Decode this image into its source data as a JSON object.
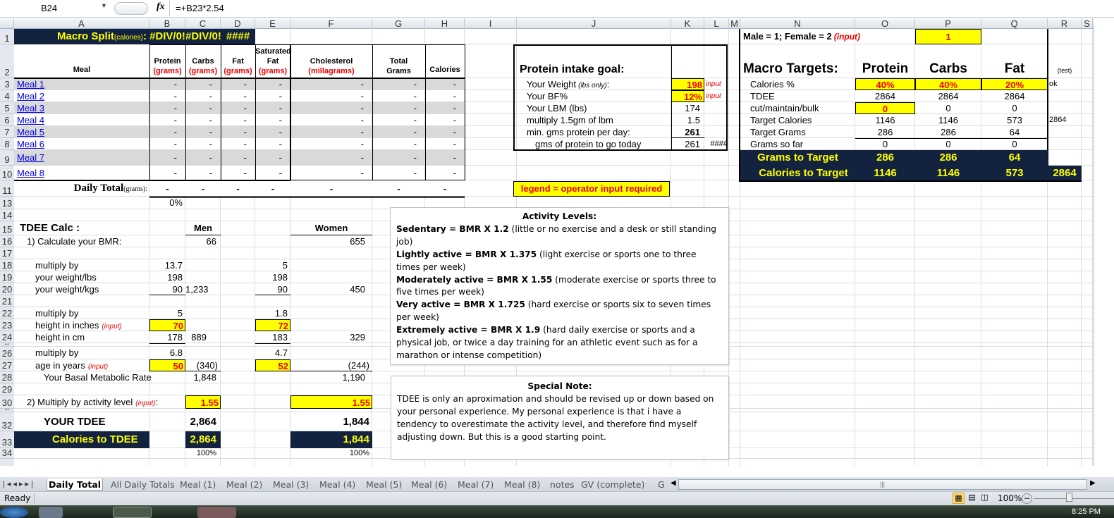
{
  "formula_bar": {
    "name_box": "B24",
    "fx_icon": "fx",
    "formula": "=+B23*2.54"
  },
  "columns": [
    "A",
    "B",
    "C",
    "D",
    "E",
    "F",
    "G",
    "H",
    "I",
    "J",
    "K",
    "L",
    "M",
    "N",
    "O",
    "P",
    "Q",
    "R",
    "S"
  ],
  "rows": [
    "1",
    "2",
    "3",
    "4",
    "5",
    "6",
    "7",
    "8",
    "9",
    "10",
    "11",
    "13",
    "14",
    "15",
    "16",
    "17",
    "18",
    "19",
    "20",
    "21",
    "22",
    "23",
    "24",
    "25",
    "26",
    "27",
    "28",
    "29",
    "30",
    "31",
    "32",
    "33",
    "34"
  ],
  "macro_split": {
    "label": "Macro Split",
    "label_sub": "(calories)",
    "label_colon": ":",
    "protein": "#DIV/0!",
    "carbs": "#DIV/0!",
    "fat": "####"
  },
  "meal_table": {
    "headers": {
      "meal": "Meal",
      "protein": "Protein",
      "carbs": "Carbs",
      "fat": "Fat",
      "sat1": "Saturated",
      "sat2": "Fat",
      "chol": "Cholesterol",
      "total1": "Total",
      "total2": "Grams",
      "calories": "Calories",
      "grams": "(grams)",
      "mg": "(millagrams)"
    },
    "meals": [
      {
        "name": "Meal 1",
        "values": [
          "-",
          "-",
          "-",
          "-",
          "-",
          "-",
          "-"
        ]
      },
      {
        "name": "Meal 2",
        "values": [
          "-",
          "-",
          "-",
          "-",
          "-",
          "-",
          "-"
        ]
      },
      {
        "name": "Meal 3",
        "values": [
          "-",
          "-",
          "-",
          "-",
          "-",
          "-",
          "-"
        ]
      },
      {
        "name": "Meal 4",
        "values": [
          "-",
          "-",
          "-",
          "-",
          "-",
          "-",
          "-"
        ]
      },
      {
        "name": "Meal 5",
        "values": [
          "-",
          "-",
          "-",
          "-",
          "-",
          "-",
          "-"
        ]
      },
      {
        "name": "Meal 6",
        "values": [
          "-",
          "-",
          "-",
          "-",
          "-",
          "-",
          "-"
        ]
      },
      {
        "name": "Meal 7",
        "values": [
          "-",
          "-",
          "-",
          "-",
          "-",
          "-",
          "-"
        ]
      },
      {
        "name": "Meal 8",
        "values": [
          "-",
          "-",
          "-",
          "-",
          "-",
          "-",
          "-"
        ]
      }
    ],
    "daily_total_label": "Daily Total",
    "daily_total_sub": "(grams):",
    "daily_total": [
      "-",
      "-",
      "-",
      "-",
      "-",
      "-",
      "-"
    ],
    "pct": "0%"
  },
  "protein_goal": {
    "title": "Protein intake goal:",
    "weight_label": "Your Weight",
    "weight_sub": "(lbs only)",
    "weight_colon": ":",
    "weight": "198",
    "input_note": "input",
    "bf_label": "Your BF%",
    "bf": "12%",
    "lbm_label": "Your LBM (lbs)",
    "lbm": "174",
    "mult_label": "multiply 1.5gm of lbm",
    "mult": "1.5",
    "min_label": "min. gms protein per day:",
    "min": "261",
    "togo_label": "gms of protein to go today",
    "togo": "261",
    "togo_extra": "####"
  },
  "legend": "legend = operator input required",
  "gender": {
    "label": "Male = 1; Female = 2",
    "note": "(input)",
    "value": "1"
  },
  "macro_targets": {
    "title": "Macro Targets:",
    "cols": [
      "Protein",
      "Carbs",
      "Fat"
    ],
    "test": "(test)",
    "rows": [
      {
        "label": "Calories %",
        "values": [
          "40%",
          "40%",
          "20%"
        ],
        "extra": "ok"
      },
      {
        "label": "TDEE",
        "values": [
          "2864",
          "2864",
          "2864"
        ],
        "extra": ""
      },
      {
        "label": "cut/maintain/bulk",
        "values": [
          "0",
          "0",
          "0"
        ],
        "extra": ""
      },
      {
        "label": "Target Calories",
        "values": [
          "1146",
          "1146",
          "573"
        ],
        "extra": "2864"
      },
      {
        "label": "Target Grams",
        "values": [
          "286",
          "286",
          "64"
        ],
        "extra": ""
      },
      {
        "label": "Grams so far",
        "values": [
          "0",
          "0",
          "0"
        ],
        "extra": ""
      }
    ],
    "grams_to_target": {
      "label": "Grams to Target",
      "values": [
        "286",
        "286",
        "64"
      ]
    },
    "calories_to_target": {
      "label": "Calories to Target",
      "values": [
        "1146",
        "1146",
        "573"
      ],
      "total": "2864"
    }
  },
  "tdee": {
    "title": "TDEE Calc :",
    "men": "Men",
    "women": "Women",
    "step1": "1) Calculate your BMR:",
    "men_base": "66",
    "women_base": "655",
    "mult_label": "multiply by",
    "weight_lbs_label": "your weight/lbs",
    "weight_kgs_label": "your weight/kgs",
    "men_w": [
      "13.7",
      "198",
      "90"
    ],
    "men_w_result": "1,233",
    "women_w": [
      "5",
      "198",
      "90"
    ],
    "women_w_result": "450",
    "height_in_label": "height in inches",
    "height_cm_label": "height in cm",
    "input_note": "(input)",
    "men_h": [
      "5",
      "70",
      "178"
    ],
    "men_h_result": "889",
    "women_h": [
      "1.8",
      "72",
      "183"
    ],
    "women_h_result": "329",
    "age_label": "age in years",
    "men_a": [
      "6.8",
      "50"
    ],
    "men_a_result": "(340)",
    "women_a": [
      "4.7",
      "52"
    ],
    "women_a_result": "(244)",
    "bmr_label": "Your Basal Metabolic Rate",
    "men_bmr": "1,848",
    "women_bmr": "1,190",
    "step2": "2) Multiply by activity level",
    "step2_colon": ":",
    "men_act": "1.55",
    "women_act": "1.55",
    "your_tdee": "YOUR TDEE",
    "men_tdee": "2,864",
    "women_tdee": "1,844",
    "cal_to_tdee": "Calories to TDEE",
    "men_cal": "2,864",
    "women_cal": "1,844",
    "men_pct": "100%",
    "women_pct": "100%"
  },
  "activity_box": {
    "title": "Activity Levels:",
    "items": [
      {
        "bold": "Sedentary = BMR X 1.2",
        "text": " (little or no exercise and a desk or still standing job)"
      },
      {
        "bold": "Lightly active = BMR X 1.375",
        "text": "  (light exercise or sports one to three times per week)"
      },
      {
        "bold": "Moderately active = BMR X 1.55",
        "text": "  (moderate exercise or sports three to five times per week)"
      },
      {
        "bold": "Very active = BMR X 1.725",
        "text": "  (hard exercise or sports six to seven times per week)"
      },
      {
        "bold": "Extremely active = BMR X 1.9",
        "text": " (hard daily exercise or sports and a physical job, or twice a day training for an athletic event such as for a  marathon or intense competition)"
      }
    ]
  },
  "special_note": {
    "title": "Special Note:",
    "text": "TDEE is only an aproximation and should be revised up or down based on your personal experience.  My personal experience is that i have a tendency to overestimate the activity level, and therefore find myself adjusting down. But this is a good starting point."
  },
  "sheet_tabs": [
    "Daily Total",
    "All Daily Totals",
    "Meal (1)",
    "Meal (2)",
    "Meal (3)",
    "Meal (4)",
    "Meal (5)",
    "Meal (6)",
    "Meal (7)",
    "Meal (8)",
    "notes",
    "GV (complete)",
    "G"
  ],
  "active_tab": "Daily Total",
  "status": {
    "ready": "Ready",
    "zoom": "100%",
    "clock": "8:25 PM"
  },
  "colors": {
    "navy": "#13233f",
    "highlight": "#ffff00",
    "input_red": "#ee0000",
    "link": "#0000ee"
  }
}
